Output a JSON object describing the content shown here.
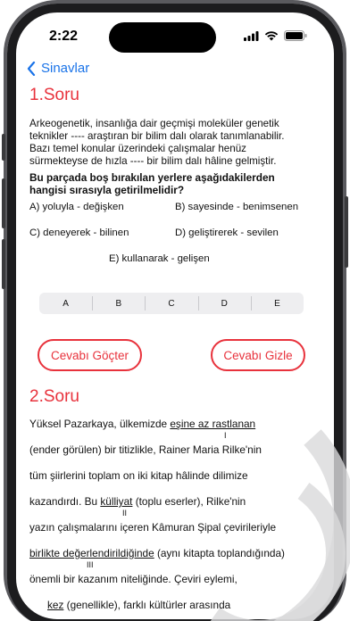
{
  "status": {
    "time": "2:22"
  },
  "nav": {
    "back_label": "Sinavlar"
  },
  "q1": {
    "title": "1.Soru",
    "passage": [
      "Arkeogenetik, insanlığa dair geçmişi moleküler genetik",
      "teknikler ---- araştıran bir bilim dalı olarak tanımlanabilir.",
      "Bazı temel konular üzerindeki çalışmalar henüz",
      "sürmekteyse de hızla ---- bir bilim dalı hâline gelmiştir."
    ],
    "prompt": [
      "Bu parçada boş bırakılan yerlere aşağıdakilerden",
      "hangisi sırasıyla getirilmelidir?"
    ],
    "options": {
      "a": "A) yoluyla - değişken",
      "b": "B) sayesinde - benimsenen",
      "c": "C) deneyerek - bilinen",
      "d": "D) geliştirerek - sevilen",
      "e": "E) kullanarak - gelişen"
    },
    "answer_choices": [
      "A",
      "B",
      "C",
      "D",
      "E"
    ],
    "show_answer_label": "Cevabı Göçter",
    "hide_answer_label": "Cevabı Gizle"
  },
  "q2": {
    "title": "2.Soru",
    "l1a": "Yüksel Pazarkaya, ülkemizde ",
    "l1u": "eşine az rastlanan",
    "l2": "(ender görülen) bir titizlikle, Rainer Maria Rilke'nin",
    "l3": "tüm şiirlerini toplam on iki kitap hâlinde dilimize",
    "l4a": "kazandırdı. Bu ",
    "l4u": "külliyat",
    "l4b": " (toplu eserler), Rilke'nin",
    "l5": "yazın çalışmalarını içeren Kâmuran Şipal çevirileriyle",
    "l6u": "birlikte değerlendirildiğinde",
    "l6b": " (aynı kitapta toplandığında)",
    "l7": "önemli bir kazanım niteliğinde. Çeviri eylemi,",
    "l8a": "",
    "l8u": "kez",
    "l8b": " (genellikle), farklı kültürler arasında",
    "roman1": "I",
    "roman2": "II",
    "roman3": "III"
  },
  "colors": {
    "accent": "#e8323c",
    "link": "#1a73e8"
  }
}
